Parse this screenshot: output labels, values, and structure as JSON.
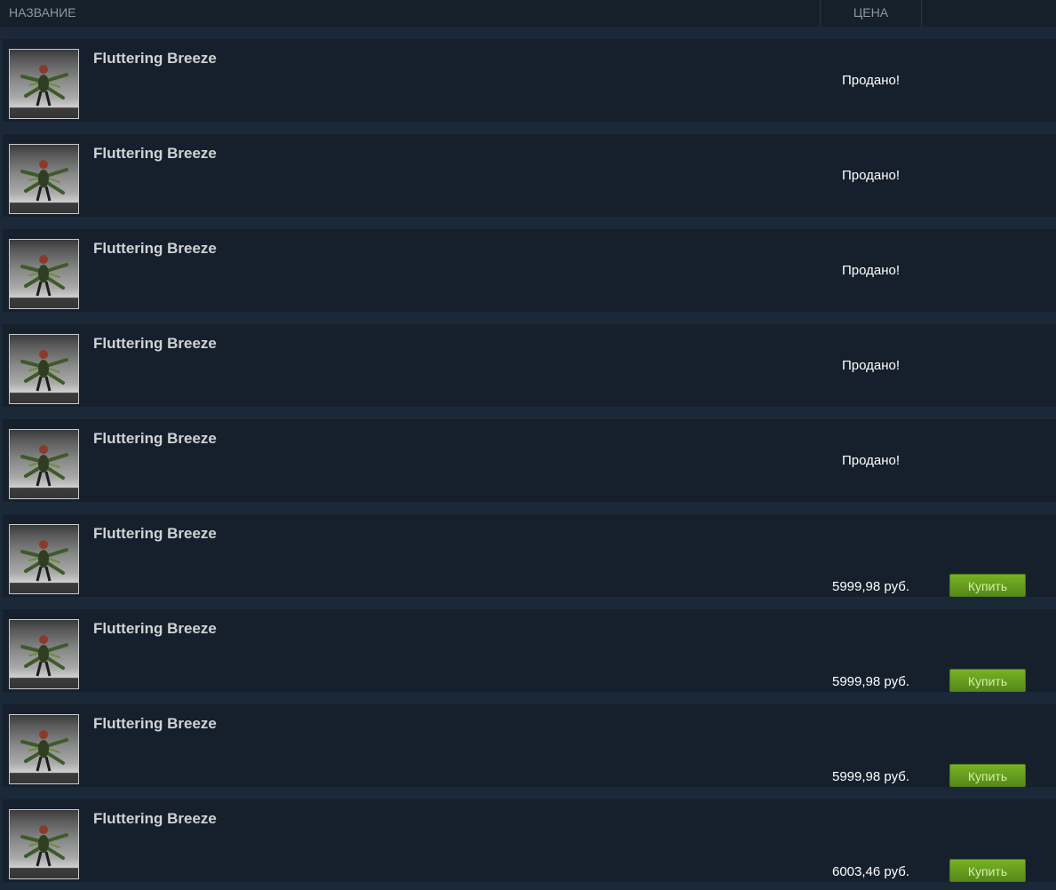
{
  "header": {
    "name_label": "НАЗВАНИЕ",
    "price_label": "ЦЕНА"
  },
  "listings": [
    {
      "name": "Fluttering Breeze",
      "price": "Продано!",
      "status": "sold"
    },
    {
      "name": "Fluttering Breeze",
      "price": "Продано!",
      "status": "sold"
    },
    {
      "name": "Fluttering Breeze",
      "price": "Продано!",
      "status": "sold"
    },
    {
      "name": "Fluttering Breeze",
      "price": "Продано!",
      "status": "sold"
    },
    {
      "name": "Fluttering Breeze",
      "price": "Продано!",
      "status": "sold"
    },
    {
      "name": "Fluttering Breeze",
      "price": "5999,98 руб.",
      "status": "available",
      "buy_label": "Купить"
    },
    {
      "name": "Fluttering Breeze",
      "price": "5999,98 руб.",
      "status": "available",
      "buy_label": "Купить"
    },
    {
      "name": "Fluttering Breeze",
      "price": "5999,98 руб.",
      "status": "available",
      "buy_label": "Купить"
    },
    {
      "name": "Fluttering Breeze",
      "price": "6003,46 руб.",
      "status": "available",
      "buy_label": "Купить"
    }
  ],
  "colors": {
    "page_bg": "#1b2838",
    "row_bg": "#16202d",
    "item_name": "#d2d2d2",
    "buy_button": "#75b022",
    "buy_text": "#d2efa9"
  },
  "icons": {
    "item_image": "windrunner-item-icon"
  }
}
